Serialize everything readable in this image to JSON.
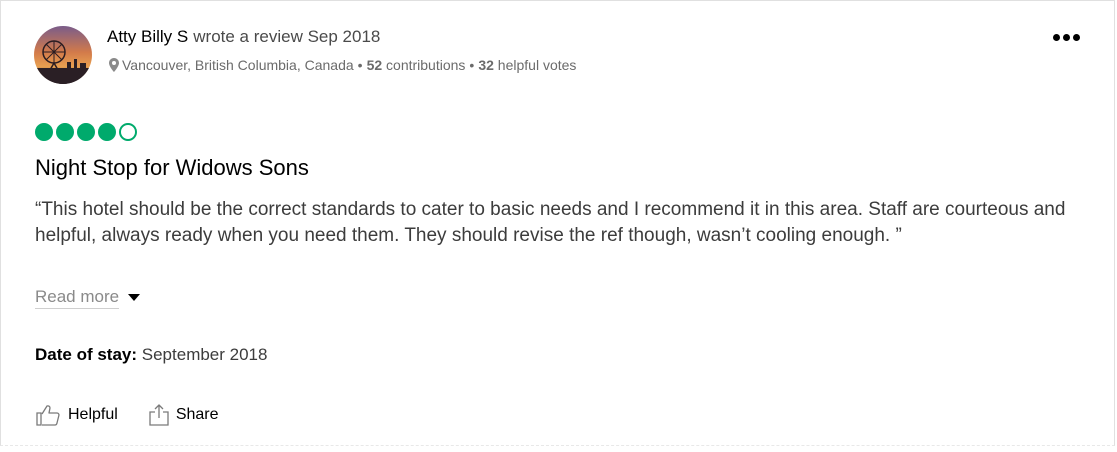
{
  "review": {
    "author": "Atty Billy S",
    "action": "wrote a review Sep 2018",
    "location": "Vancouver, British Columbia, Canada",
    "contributions_count": "52",
    "contributions_label": "contributions",
    "helpful_count": "32",
    "helpful_label": "helpful votes",
    "separator": "•",
    "rating": {
      "value": 4,
      "max": 5
    },
    "title": "Night Stop for Widows Sons",
    "text": "“This hotel should be the correct standards to cater to basic needs and I recommend it in this area. Staff are courteous and helpful, always ready when you need them. They should revise the ref though, wasn’t cooling enough. ”",
    "read_more": "Read more",
    "date_of_stay_label": "Date of stay:",
    "date_of_stay_value": "September 2018"
  },
  "actions": {
    "helpful": "Helpful",
    "share": "Share"
  },
  "icons": {
    "avatar": "avatar-photo",
    "location": "location-pin-icon",
    "more": "more-options-icon",
    "read_more": "caret-down-icon",
    "helpful": "thumbs-up-icon",
    "share": "share-icon"
  },
  "colors": {
    "rating_bubble": "#00aa6c",
    "text": "#3c3c3c",
    "muted": "#6b6b6b"
  }
}
